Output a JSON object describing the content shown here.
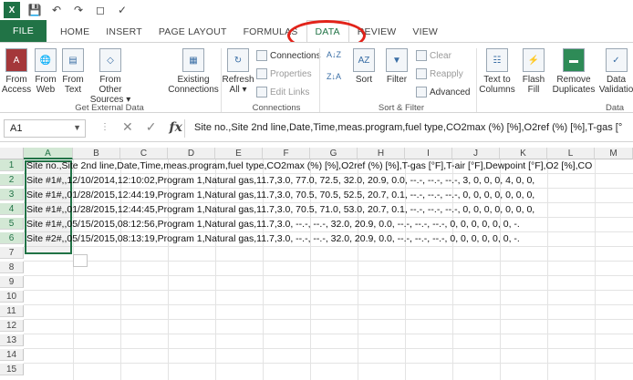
{
  "titlebar": {
    "app_icon": "X",
    "qat_icons": [
      "save-icon",
      "undo-icon",
      "redo-icon",
      "print-preview-icon",
      "spelling-icon"
    ]
  },
  "tabs": [
    "FILE",
    "HOME",
    "INSERT",
    "PAGE LAYOUT",
    "FORMULAS",
    "DATA",
    "REVIEW",
    "VIEW"
  ],
  "active_tab": "DATA",
  "ribbon": {
    "get_external": {
      "label": "Get External Data",
      "access": "From Access",
      "web": "From Web",
      "text": "From Text",
      "other": "From Other Sources ▾",
      "existing": "Existing Connections"
    },
    "connections": {
      "label": "Connections",
      "refresh": "Refresh All ▾",
      "connections": "Connections",
      "properties": "Properties",
      "edit_links": "Edit Links"
    },
    "sort_filter": {
      "label": "Sort & Filter",
      "sort": "Sort",
      "filter": "Filter",
      "clear": "Clear",
      "reapply": "Reapply",
      "advanced": "Advanced"
    },
    "data_tools": {
      "label": "Data",
      "text_to_columns": "Text to Columns",
      "flash_fill": "Flash Fill",
      "remove_duplicates": "Remove Duplicates",
      "data_validation": "Data Validatio"
    }
  },
  "formula_bar": {
    "name_box": "A1",
    "fx": "fx",
    "formula": "Site no.,Site 2nd line,Date,Time,meas.program,fuel type,CO2max (%) [%],O2ref (%) [%],T-gas [°"
  },
  "columns": [
    "A",
    "B",
    "C",
    "D",
    "E",
    "F",
    "G",
    "H",
    "I",
    "J",
    "K",
    "L",
    "M"
  ],
  "rows": [
    "Site no.,Site 2nd line,Date,Time,meas.program,fuel type,CO2max (%) [%],O2ref (%) [%],T-gas [°F],T-air [°F],Dewpoint [°F],O2 [%],CO",
    "Site #1#,,12/10/2014,12:10:02,Program 1,Natural gas,11.7,3.0, 77.0, 72.5, 32.0, 20.9, 0.0, --.-, --.-, --.-,   3,   0,   0,   0,   4,   0,   0,",
    "Site #1#,,01/28/2015,12:44:19,Program 1,Natural gas,11.7,3.0, 70.5, 70.5, 52.5, 20.7, 0.1, --.-, --.-, --.-,   0,   0,   0,   0,   0,   0,   0,",
    "Site #1#,,01/28/2015,12:44:45,Program 1,Natural gas,11.7,3.0, 70.5, 71.0, 53.0, 20.7, 0.1, --.-, --.-, --.-,   0,   0,   0,   0,   0,   0,   0,",
    "Site #1#,,05/15/2015,08:12:56,Program 1,Natural gas,11.7,3.0, --.-, --.-, 32.0, 20.9, 0.0, --.-, --.-, --.-,   0,   0,   0,   0,   0,   0,   -.",
    "Site #2#,,05/15/2015,08:13:19,Program 1,Natural gas,11.7,3.0, --.-, --.-, 32.0, 20.9, 0.0, --.-, --.-, --.-,   0,   0,   0,   0,   0,   0,   -."
  ],
  "row_numbers": [
    "1",
    "2",
    "3",
    "4",
    "5",
    "6",
    "7",
    "8",
    "9",
    "10",
    "11",
    "12",
    "13",
    "14",
    "15"
  ],
  "colors": {
    "accent": "#217346",
    "highlight_ring": "#e2231a"
  }
}
